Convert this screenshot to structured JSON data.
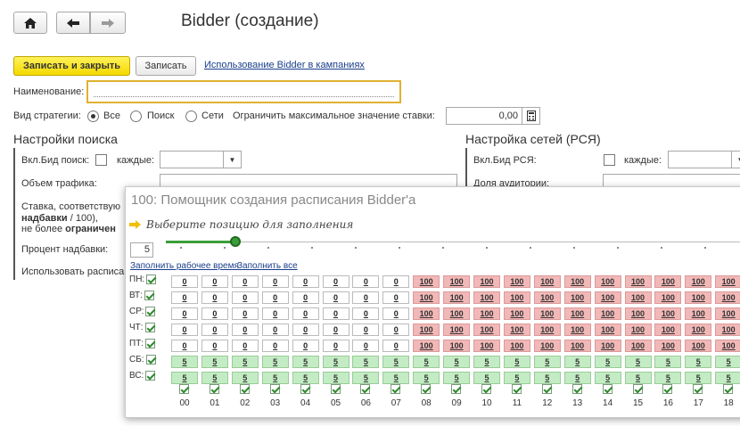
{
  "title": "Bidder (создание)",
  "toolbar": {
    "save_close": "Записать и закрыть",
    "save": "Записать",
    "link": "Использование Bidder в кампаниях"
  },
  "form": {
    "name_label": "Наименование:",
    "name_value": "",
    "strategy_label": "Вид стратегии:",
    "strategy_options": [
      "Все",
      "Поиск",
      "Сети"
    ],
    "strategy_selected": "Все",
    "limit_label": "Ограничить максимальное значение ставки:",
    "limit_value": "0,00"
  },
  "search": {
    "header": "Настройки поиска",
    "enable_label": "Вкл.Бид поиск:",
    "every_label": "каждые:",
    "traffic_label": "Объем трафика:",
    "rate_line1": "Ставка, соответствую",
    "rate_line2_bold": "надбавки",
    "rate_line2_rest": " / 100),",
    "rate_line3": "не более ",
    "rate_line3_bold": "ограничен",
    "percent_label": "Процент надбавки:",
    "schedule_label": "Использовать расписа"
  },
  "networks": {
    "header": "Настройка сетей (РСЯ)",
    "enable_label": "Вкл.Бид РСЯ:",
    "every_label": "каждые:",
    "audience_label": "Доля аудитории:"
  },
  "modal": {
    "title": "100: Помощник создания расписания Bidder'а",
    "hint": "Выберите позицию для заполнения",
    "position_value": "5",
    "fill_work": "Заполнить рабочее время",
    "fill_all": "Заполнить все",
    "days": [
      "ПН:",
      "ВТ:",
      "СР:",
      "ЧТ:",
      "ПТ:",
      "СБ:",
      "ВС:"
    ],
    "hours": [
      "00",
      "01",
      "02",
      "03",
      "04",
      "05",
      "06",
      "07",
      "08",
      "09",
      "10",
      "11",
      "12",
      "13",
      "14",
      "15",
      "16",
      "17",
      "18"
    ],
    "weekday_values": [
      "0",
      "0",
      "0",
      "0",
      "0",
      "0",
      "0",
      "0",
      "100",
      "100",
      "100",
      "100",
      "100",
      "100",
      "100",
      "100",
      "100",
      "100",
      "100"
    ],
    "weekend_values": [
      "5",
      "5",
      "5",
      "5",
      "5",
      "5",
      "5",
      "5",
      "5",
      "5",
      "5",
      "5",
      "5",
      "5",
      "5",
      "5",
      "5",
      "5",
      "5"
    ],
    "colors": {
      "zero": "#ffffff",
      "high": "#f2b8b8",
      "low": "#c4ecc4"
    }
  }
}
